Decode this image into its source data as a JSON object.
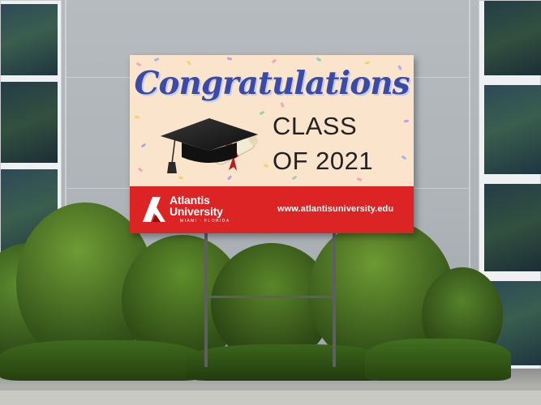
{
  "sign": {
    "headline": "Congratulations",
    "class_line_1": "CLASS",
    "class_line_2": "OF 2021",
    "logo_name_line_1": "Atlantis",
    "logo_name_line_2": "University",
    "logo_tagline": "MIAMI · FLORIDA",
    "website": "www.atlantisuniversity.edu"
  },
  "colors": {
    "headline": "#3a4aa8",
    "sign_background": "#fbe4cc",
    "band": "#dc2424",
    "text_dark": "#222222",
    "text_light": "#ffffff"
  },
  "icons": [
    "graduation-cap-icon",
    "diploma-scroll-icon",
    "atlantis-logo-icon"
  ]
}
